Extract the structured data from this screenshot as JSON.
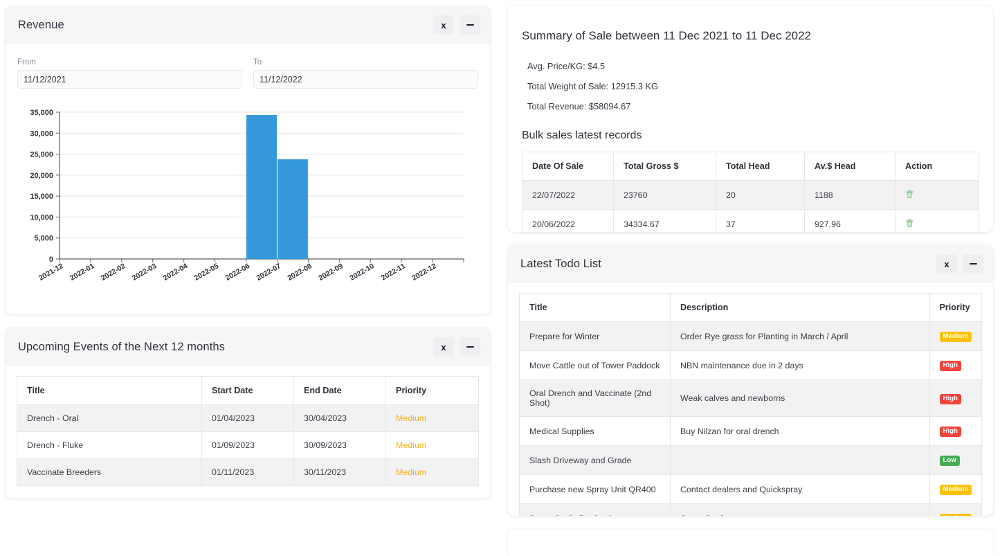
{
  "revenue_panel": {
    "title": "Revenue",
    "close_label": "x",
    "minimize_label": "—",
    "from_label": "From",
    "to_label": "To",
    "from_value": "11/12/2021",
    "to_value": "11/12/2022"
  },
  "chart_data": {
    "type": "bar",
    "title": "",
    "xlabel": "",
    "ylabel": "",
    "categories": [
      "2021-12",
      "2022-01",
      "2022-02",
      "2022-03",
      "2022-04",
      "2022-05",
      "2022-06",
      "2022-07",
      "2022-08",
      "2022-09",
      "2022-10",
      "2022-11",
      "2022-12"
    ],
    "values": [
      0,
      0,
      0,
      0,
      0,
      0,
      34334.67,
      23760,
      0,
      0,
      0,
      0,
      0
    ],
    "ylim": [
      0,
      35000
    ],
    "yticks": [
      0,
      5000,
      10000,
      15000,
      20000,
      25000,
      30000,
      35000
    ],
    "ytick_labels": [
      "0",
      "5,000",
      "10,000",
      "15,000",
      "20,000",
      "25,000",
      "30,000",
      "35,000"
    ],
    "grid": true,
    "legend": "none",
    "bar_color": "#3498db"
  },
  "summary_panel": {
    "title": "Summary of Sale between 11 Dec 2021 to 11 Dec 2022",
    "lines": [
      "Avg. Price/KG: $4.5",
      "Total Weight of Sale: 12915.3 KG",
      "Total Revenue: $58094.67"
    ],
    "bulk_title": "Bulk sales latest records",
    "bulk_table": {
      "columns": [
        "Date Of Sale",
        "Total Gross $",
        "Total Head",
        "Av.$ Head",
        "Action"
      ],
      "rows": [
        {
          "date": "22/07/2022",
          "gross": "23760",
          "head": "20",
          "avg": "1188",
          "action_icon": "trash-icon"
        },
        {
          "date": "20/06/2022",
          "gross": "34334.67",
          "head": "37",
          "avg": "927.96",
          "action_icon": "trash-icon"
        }
      ]
    }
  },
  "todo_panel": {
    "title": "Latest Todo List",
    "close_label": "x",
    "minimize_label": "—",
    "columns": [
      "Title",
      "Description",
      "Priority"
    ],
    "rows": [
      {
        "title": "Prepare for Winter",
        "description": "Order Rye grass for Planting in March / April",
        "priority": "Medium",
        "priority_class": "medium"
      },
      {
        "title": "Move Cattle out of Tower Paddock",
        "description": "NBN maintenance due in 2 days",
        "priority": "High",
        "priority_class": "high"
      },
      {
        "title": "Oral Drench and Vaccinate (2nd Shot)",
        "description": "Weak calves and newborns",
        "priority": "High",
        "priority_class": "high"
      },
      {
        "title": "Medical Supplies",
        "description": "Buy Nilzan for oral drench",
        "priority": "High",
        "priority_class": "high"
      },
      {
        "title": "Slash Driveway and Grade",
        "description": "",
        "priority": "Low",
        "priority_class": "low"
      },
      {
        "title": "Purchase new Spray Unit QR400",
        "description": "Contact dealers and Quickspray",
        "priority": "Medium",
        "priority_class": "medium"
      },
      {
        "title": "Spray Cattle Barricade",
        "description": "Spray Cattle",
        "priority": "Medium",
        "priority_class": "medium"
      }
    ]
  },
  "events_panel": {
    "title": "Upcoming Events of the Next 12 months",
    "close_label": "x",
    "minimize_label": "—",
    "columns": [
      "Title",
      "Start Date",
      "End Date",
      "Priority"
    ],
    "rows": [
      {
        "title": "Drench - Oral",
        "start": "01/04/2023",
        "end": "30/04/2023",
        "priority": "Medium"
      },
      {
        "title": "Drench - Fluke",
        "start": "01/09/2023",
        "end": "30/09/2023",
        "priority": "Medium"
      },
      {
        "title": "Vaccinate Breeders",
        "start": "01/11/2023",
        "end": "30/11/2023",
        "priority": "Medium"
      }
    ]
  },
  "colors": {
    "bar": "#3498db",
    "badge_medium": "#ffc107",
    "badge_high": "#f4433a",
    "badge_low": "#45ad52",
    "priority_text": "#f2b01e",
    "trash": "#7cb87c"
  }
}
